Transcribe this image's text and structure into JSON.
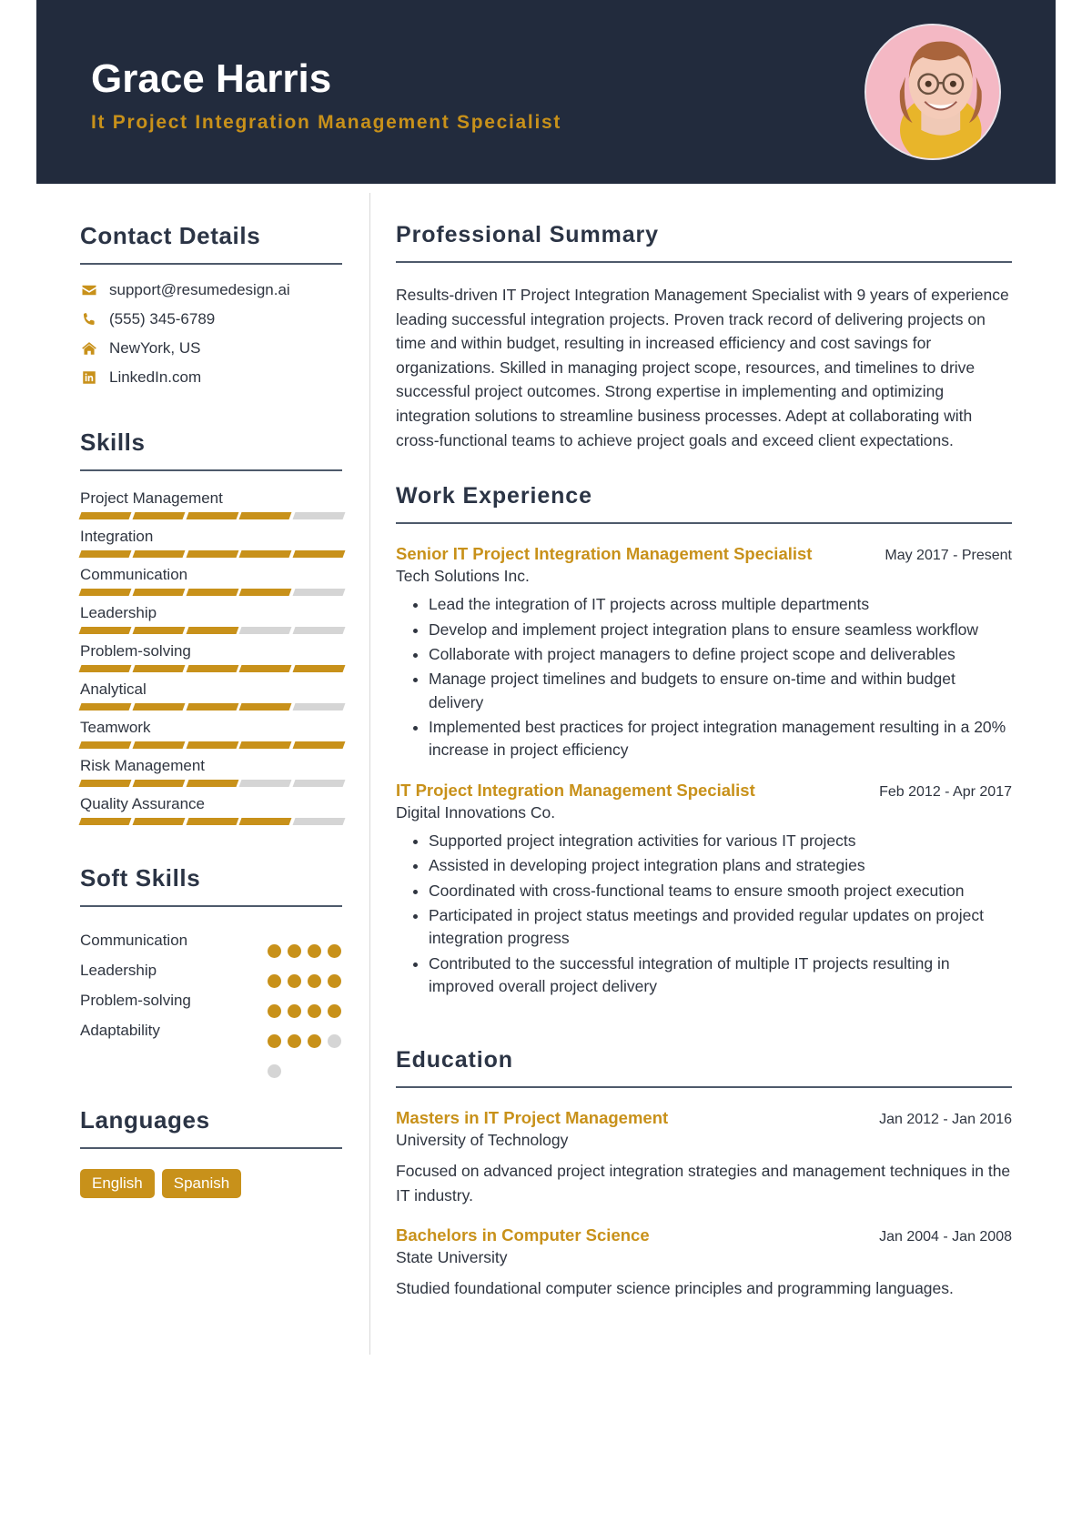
{
  "colors": {
    "header_bg": "#222b3d",
    "accent": "#c8911a",
    "text": "#2f3540",
    "muted_bar": "#d5d5d5",
    "rule": "#4e5a6b",
    "avatar_bg": "#f4b8c4"
  },
  "header": {
    "name": "Grace Harris",
    "title": "It Project Integration Management Specialist",
    "avatar_alt": "profile-photo"
  },
  "sidebar": {
    "contact": {
      "heading": "Contact Details",
      "items": [
        {
          "icon": "envelope-icon",
          "value": "support@resumedesign.ai"
        },
        {
          "icon": "phone-icon",
          "value": "(555) 345-6789"
        },
        {
          "icon": "home-icon",
          "value": "NewYork, US"
        },
        {
          "icon": "linkedin-icon",
          "value": "LinkedIn.com"
        }
      ]
    },
    "skills": {
      "heading": "Skills",
      "segments_total": 5,
      "items": [
        {
          "label": "Project Management",
          "filled": 4
        },
        {
          "label": "Integration",
          "filled": 5
        },
        {
          "label": "Communication",
          "filled": 4
        },
        {
          "label": "Leadership",
          "filled": 3
        },
        {
          "label": "Problem-solving",
          "filled": 5
        },
        {
          "label": "Analytical",
          "filled": 4
        },
        {
          "label": "Teamwork",
          "filled": 5
        },
        {
          "label": "Risk Management",
          "filled": 3
        },
        {
          "label": "Quality Assurance",
          "filled": 4
        }
      ]
    },
    "soft_skills": {
      "heading": "Soft Skills",
      "dots_total": 4,
      "items": [
        {
          "label": "Communication",
          "filled": 4
        },
        {
          "label": "Leadership",
          "filled": 4
        },
        {
          "label": "Problem-solving",
          "filled": 4
        },
        {
          "label": "Adaptability",
          "filled": 3
        }
      ]
    },
    "languages": {
      "heading": "Languages",
      "items": [
        "English",
        "Spanish"
      ]
    }
  },
  "main": {
    "summary": {
      "heading": "Professional Summary",
      "text": "Results-driven IT Project Integration Management Specialist with 9 years of experience leading successful integration projects. Proven track record of delivering projects on time and within budget, resulting in increased efficiency and cost savings for organizations. Skilled in managing project scope, resources, and timelines to drive successful project outcomes. Strong expertise in implementing and optimizing integration solutions to streamline business processes. Adept at collaborating with cross-functional teams to achieve project goals and exceed client expectations."
    },
    "work": {
      "heading": "Work Experience",
      "entries": [
        {
          "title": "Senior IT Project Integration Management Specialist",
          "date": "May 2017 - Present",
          "company": "Tech Solutions Inc.",
          "bullets": [
            "Lead the integration of IT projects across multiple departments",
            "Develop and implement project integration plans to ensure seamless workflow",
            "Collaborate with project managers to define project scope and deliverables",
            "Manage project timelines and budgets to ensure on-time and within budget delivery",
            "Implemented best practices for project integration management resulting in a 20% increase in project efficiency"
          ]
        },
        {
          "title": "IT Project Integration Management Specialist",
          "date": "Feb 2012 - Apr 2017",
          "company": "Digital Innovations Co.",
          "bullets": [
            "Supported project integration activities for various IT projects",
            "Assisted in developing project integration plans and strategies",
            "Coordinated with cross-functional teams to ensure smooth project execution",
            "Participated in project status meetings and provided regular updates on project integration progress",
            "Contributed to the successful integration of multiple IT projects resulting in improved overall project delivery"
          ]
        }
      ]
    },
    "education": {
      "heading": "Education",
      "entries": [
        {
          "title": "Masters in IT Project Management",
          "date": "Jan 2012 - Jan 2016",
          "school": "University of Technology",
          "description": "Focused on advanced project integration strategies and management techniques in the IT industry."
        },
        {
          "title": "Bachelors in Computer Science",
          "date": "Jan 2004 - Jan 2008",
          "school": "State University",
          "description": "Studied foundational computer science principles and programming languages."
        }
      ]
    }
  }
}
